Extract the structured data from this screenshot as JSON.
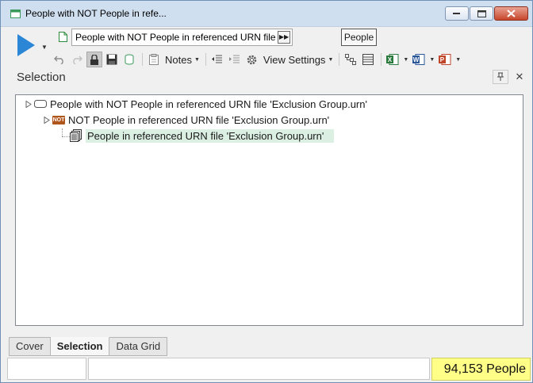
{
  "window": {
    "title": "People with NOT People in refe..."
  },
  "toolbar": {
    "query_value": "People with NOT People in referenced URN file",
    "entity_label": "People",
    "notes_label": "Notes",
    "view_settings_label": "View Settings"
  },
  "pane": {
    "title": "Selection"
  },
  "tree": {
    "nodes": [
      {
        "label": "People with NOT People in referenced URN file 'Exclusion Group.urn'"
      },
      {
        "label": "NOT People in referenced URN file 'Exclusion Group.urn'",
        "badge": "NOT"
      },
      {
        "label": "People in referenced URN file 'Exclusion Group.urn'"
      }
    ]
  },
  "tabs": [
    {
      "label": "Cover"
    },
    {
      "label": "Selection",
      "active": true
    },
    {
      "label": "Data Grid"
    }
  ],
  "status": {
    "count": "94,153 People",
    "count_bg": "#ffff88"
  },
  "colors": {
    "accent_blue": "#2b86d6",
    "titlebar": "#cfdff0",
    "selected_row": "#dcefe3",
    "not_badge": "#b0561c"
  },
  "icons": [
    "app-icon",
    "run-icon",
    "document-icon",
    "fast-forward-icon",
    "undo-icon",
    "redo-icon",
    "lock-icon",
    "save-icon",
    "database-icon",
    "clipboard-icon",
    "outdent-icon",
    "indent-icon",
    "gear-icon",
    "tree-icon",
    "grid-icon",
    "excel-icon",
    "word-icon",
    "powerpoint-icon",
    "pin-icon",
    "close-icon"
  ]
}
